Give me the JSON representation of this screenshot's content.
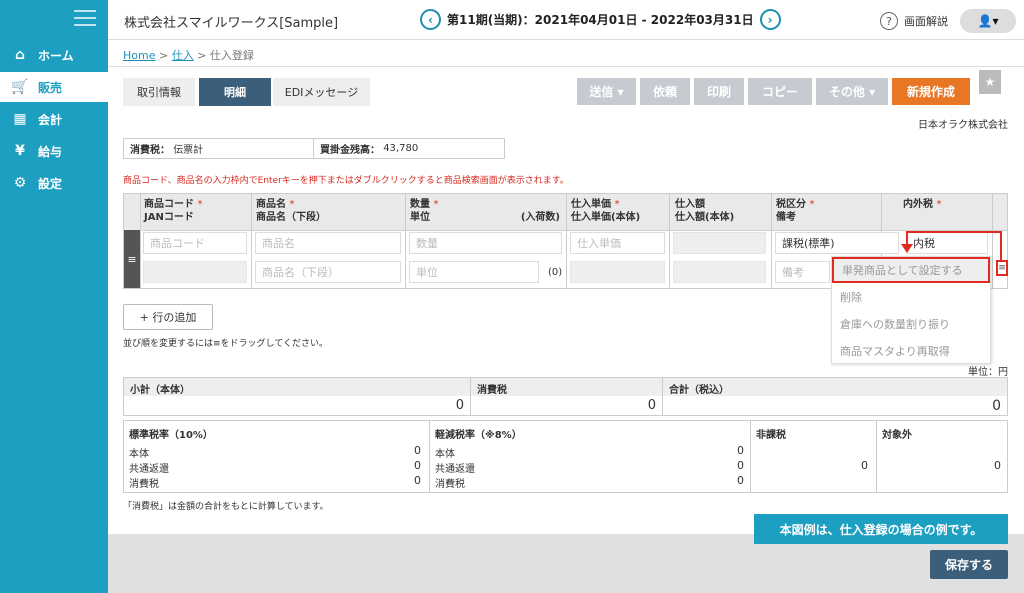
{
  "sidebar": {
    "items": [
      {
        "label": "ホーム",
        "icon": "home-icon"
      },
      {
        "label": "販売",
        "icon": "cart-icon"
      },
      {
        "label": "会計",
        "icon": "calculator-icon"
      },
      {
        "label": "給与",
        "icon": "money-bag-icon"
      },
      {
        "label": "設定",
        "icon": "gear-icon"
      }
    ]
  },
  "header": {
    "company": "株式会社スマイルワークス[Sample]",
    "period": "第11期(当期)：2021年04月01日 - 2022年03月31日",
    "help_label": "画面解説"
  },
  "breadcrumb": {
    "home": "Home",
    "sep": ">",
    "parent": "仕入",
    "current": "仕入登録"
  },
  "tabs": [
    "取引情報",
    "明細",
    "EDIメッセージ"
  ],
  "toolbar": {
    "send": "送信",
    "request": "依頼",
    "print": "印刷",
    "copy": "コピー",
    "other": "その他",
    "new": "新規作成"
  },
  "partner_name": "日本オラク株式会社",
  "info": {
    "tax_label": "消費税：",
    "tax_value": "伝票計",
    "balance_label": "買掛金残高：",
    "balance_value": "43,780"
  },
  "note": "商品コード、商品名の入力枠内でEnterキーを押下またはダブルクリックすると商品検索画面が表示されます。",
  "grid": {
    "headers": {
      "code": "商品コード",
      "jan": "JANコード",
      "name": "商品名",
      "name_lower": "商品名（下段）",
      "qty": "数量",
      "unit": "単位",
      "per_case": "(入荷数)",
      "price": "仕入単価",
      "price_body": "仕入単価(本体)",
      "amount": "仕入額",
      "amount_body": "仕入額(本体)",
      "tax_class": "税区分",
      "remarks": "備考",
      "tax_incl": "内外税",
      "req": "*"
    },
    "row": {
      "code_ph": "商品コード",
      "name_ph": "商品名",
      "name_lower_ph": "商品名（下段）",
      "qty_ph": "数量",
      "unit_ph": "単位",
      "per_case": "(0)",
      "price_ph": "仕入単価",
      "tax_class": "課税(標準)",
      "remarks_ph": "備考",
      "tax_incl": "内税"
    }
  },
  "context_menu": [
    "単発商品として設定する",
    "削除",
    "倉庫への数量割り振り",
    "商品マスタより再取得"
  ],
  "add_row": "+ 行の追加",
  "drag_hint": "並び順を変更するには≡をドラッグしてください。",
  "unit_label": "単位：円",
  "totals": {
    "subtotal_label": "小計（本体）",
    "subtotal": "0",
    "tax_label": "消費税",
    "tax": "0",
    "total_label": "合計（税込）",
    "total": "0"
  },
  "rates": {
    "standard": {
      "title": "標準税率（10%）",
      "rows": [
        "本体",
        "共通返還",
        "消費税"
      ],
      "vals": [
        "0",
        "0",
        "0"
      ]
    },
    "reduced": {
      "title": "軽減税率（※8%）",
      "rows": [
        "本体",
        "共通返還",
        "消費税"
      ],
      "vals": [
        "0",
        "0",
        "0"
      ]
    },
    "nontax": {
      "title": "非課税",
      "val": "0"
    },
    "exempt": {
      "title": "対象外",
      "val": "0"
    }
  },
  "calc_note": "「消費税」は金額の合計をもとに計算しています。",
  "caption": "本図例は、仕入登録の場合の例です。",
  "save": "保存する",
  "colors": {
    "brand": "#1d9fc2",
    "active_tab": "#3b5f7b",
    "orange": "#e87725",
    "alert": "#e02b20"
  }
}
